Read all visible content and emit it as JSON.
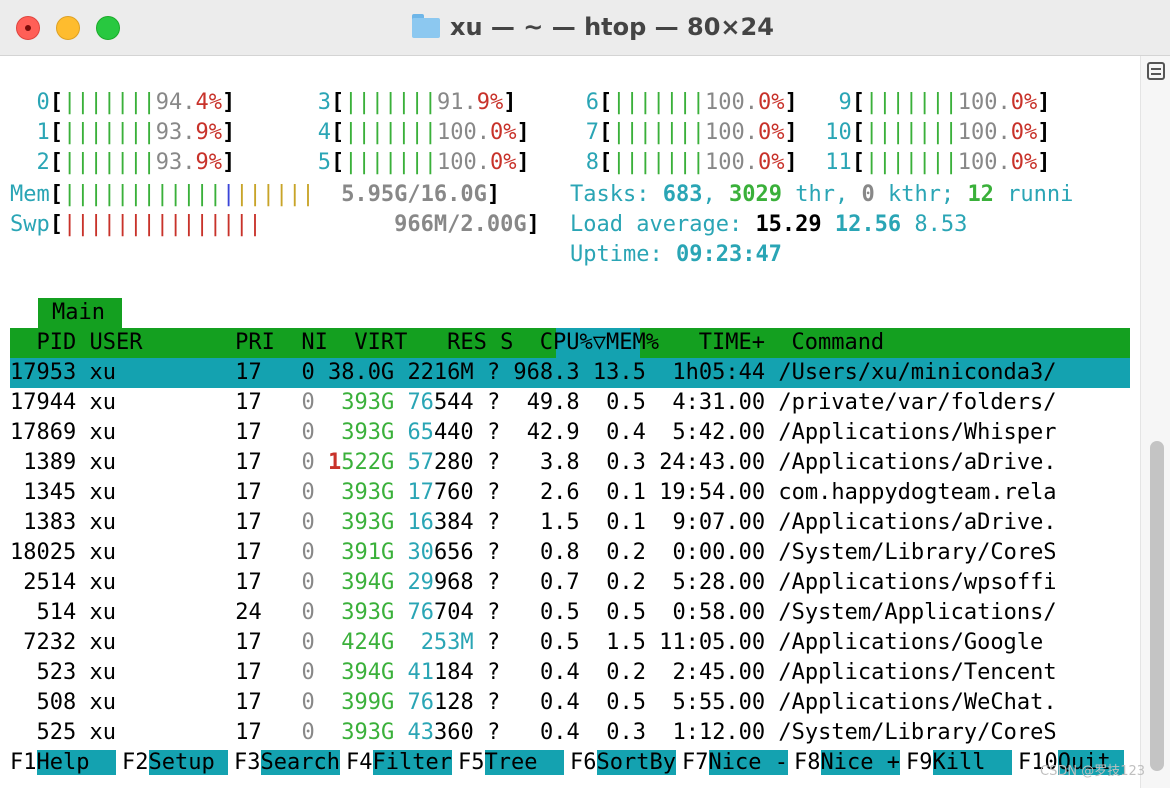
{
  "window": {
    "title": "xu — ~ — htop — 80×24"
  },
  "cpu_meters": [
    {
      "id": "0",
      "pct_a": "94.",
      "pct_b": "4%"
    },
    {
      "id": "1",
      "pct_a": "93.",
      "pct_b": "9%"
    },
    {
      "id": "2",
      "pct_a": "93.",
      "pct_b": "9%"
    },
    {
      "id": "3",
      "pct_a": "91.",
      "pct_b": "9%"
    },
    {
      "id": "4",
      "pct_a": "100.",
      "pct_b": "0%"
    },
    {
      "id": "5",
      "pct_a": "100.",
      "pct_b": "0%"
    },
    {
      "id": "6",
      "pct_a": "100.",
      "pct_b": "0%"
    },
    {
      "id": "7",
      "pct_a": "100.",
      "pct_b": "0%"
    },
    {
      "id": "8",
      "pct_a": "100.",
      "pct_b": "0%"
    },
    {
      "id": "9",
      "pct_a": "100.",
      "pct_b": "0%"
    },
    {
      "id": "10",
      "pct_a": "100.",
      "pct_b": "0%"
    },
    {
      "id": "11",
      "pct_a": "100.",
      "pct_b": "0%"
    }
  ],
  "mem": {
    "label": "Mem",
    "value": "5.95G/16.0G"
  },
  "swp": {
    "label": "Swp",
    "value": "966M/2.00G"
  },
  "tasks": {
    "label": "Tasks:",
    "count": "683",
    "threads": "3029",
    "thr_label": "thr,",
    "kthreads": "0",
    "kthr_label": "kthr;",
    "running": "12",
    "run_label": "runni"
  },
  "load": {
    "label": "Load average:",
    "v1": "15.29",
    "v5": "12.56",
    "v15": "8.53"
  },
  "uptime": {
    "label": "Uptime:",
    "value": "09:23:47"
  },
  "tab": {
    "label": "Main"
  },
  "header": "  PID USER       PRI  NI  VIRT   RES S  CPU%▽MEM%   TIME+  Command",
  "processes": [
    {
      "pid": "17953",
      "user": "xu",
      "pri": "17",
      "ni": "0",
      "virt": "38.0G",
      "res": "2216M",
      "s": "?",
      "cpu": "968.3",
      "mem": "13.5",
      "time": "1h05:44",
      "cmd": "/Users/xu/miniconda3/"
    },
    {
      "pid": "17944",
      "user": "xu",
      "pri": "17",
      "ni": "0",
      "virt": "393G",
      "res": "76544",
      "s": "?",
      "cpu": "49.8",
      "mem": "0.5",
      "time": "4:31.00",
      "cmd": "/private/var/folders/"
    },
    {
      "pid": "17869",
      "user": "xu",
      "pri": "17",
      "ni": "0",
      "virt": "393G",
      "res": "65440",
      "s": "?",
      "cpu": "42.9",
      "mem": "0.4",
      "time": "5:42.00",
      "cmd": "/Applications/Whisper"
    },
    {
      "pid": "1389",
      "user": "xu",
      "pri": "17",
      "ni": "0",
      "virt": "1522G",
      "res": "57280",
      "s": "?",
      "cpu": "3.8",
      "mem": "0.3",
      "time": "24:43.00",
      "cmd": "/Applications/aDrive."
    },
    {
      "pid": "1345",
      "user": "xu",
      "pri": "17",
      "ni": "0",
      "virt": "393G",
      "res": "17760",
      "s": "?",
      "cpu": "2.6",
      "mem": "0.1",
      "time": "19:54.00",
      "cmd": "com.happydogteam.rela"
    },
    {
      "pid": "1383",
      "user": "xu",
      "pri": "17",
      "ni": "0",
      "virt": "393G",
      "res": "16384",
      "s": "?",
      "cpu": "1.5",
      "mem": "0.1",
      "time": "9:07.00",
      "cmd": "/Applications/aDrive."
    },
    {
      "pid": "18025",
      "user": "xu",
      "pri": "17",
      "ni": "0",
      "virt": "391G",
      "res": "30656",
      "s": "?",
      "cpu": "0.8",
      "mem": "0.2",
      "time": "0:00.00",
      "cmd": "/System/Library/CoreS"
    },
    {
      "pid": "2514",
      "user": "xu",
      "pri": "17",
      "ni": "0",
      "virt": "394G",
      "res": "29968",
      "s": "?",
      "cpu": "0.7",
      "mem": "0.2",
      "time": "5:28.00",
      "cmd": "/Applications/wpsoffi"
    },
    {
      "pid": "514",
      "user": "xu",
      "pri": "24",
      "ni": "0",
      "virt": "393G",
      "res": "76704",
      "s": "?",
      "cpu": "0.5",
      "mem": "0.5",
      "time": "0:58.00",
      "cmd": "/System/Applications/"
    },
    {
      "pid": "7232",
      "user": "xu",
      "pri": "17",
      "ni": "0",
      "virt": "424G",
      "res": "253M",
      "s": "?",
      "cpu": "0.5",
      "mem": "1.5",
      "time": "11:05.00",
      "cmd": "/Applications/Google "
    },
    {
      "pid": "523",
      "user": "xu",
      "pri": "17",
      "ni": "0",
      "virt": "394G",
      "res": "41184",
      "s": "?",
      "cpu": "0.4",
      "mem": "0.2",
      "time": "2:45.00",
      "cmd": "/Applications/Tencent"
    },
    {
      "pid": "508",
      "user": "xu",
      "pri": "17",
      "ni": "0",
      "virt": "399G",
      "res": "76128",
      "s": "?",
      "cpu": "0.4",
      "mem": "0.5",
      "time": "5:55.00",
      "cmd": "/Applications/WeChat."
    },
    {
      "pid": "525",
      "user": "xu",
      "pri": "17",
      "ni": "0",
      "virt": "393G",
      "res": "43360",
      "s": "?",
      "cpu": "0.4",
      "mem": "0.3",
      "time": "1:12.00",
      "cmd": "/System/Library/CoreS"
    }
  ],
  "fkeys": [
    {
      "num": "F1",
      "label": "Help  "
    },
    {
      "num": "F2",
      "label": "Setup "
    },
    {
      "num": "F3",
      "label": "Search"
    },
    {
      "num": "F4",
      "label": "Filter"
    },
    {
      "num": "F5",
      "label": "Tree  "
    },
    {
      "num": "F6",
      "label": "SortBy"
    },
    {
      "num": "F7",
      "label": "Nice -"
    },
    {
      "num": "F8",
      "label": "Nice +"
    },
    {
      "num": "F9",
      "label": "Kill  "
    },
    {
      "num": "F10",
      "label": "Quit "
    }
  ],
  "watermark": "CSDN @罗技123",
  "colors": {
    "header_bg": "#14a020",
    "selection_bg": "#14a2b0",
    "meter_green": "#3ab03a",
    "meter_red": "#c8322a",
    "cyan": "#2aa5b5"
  }
}
